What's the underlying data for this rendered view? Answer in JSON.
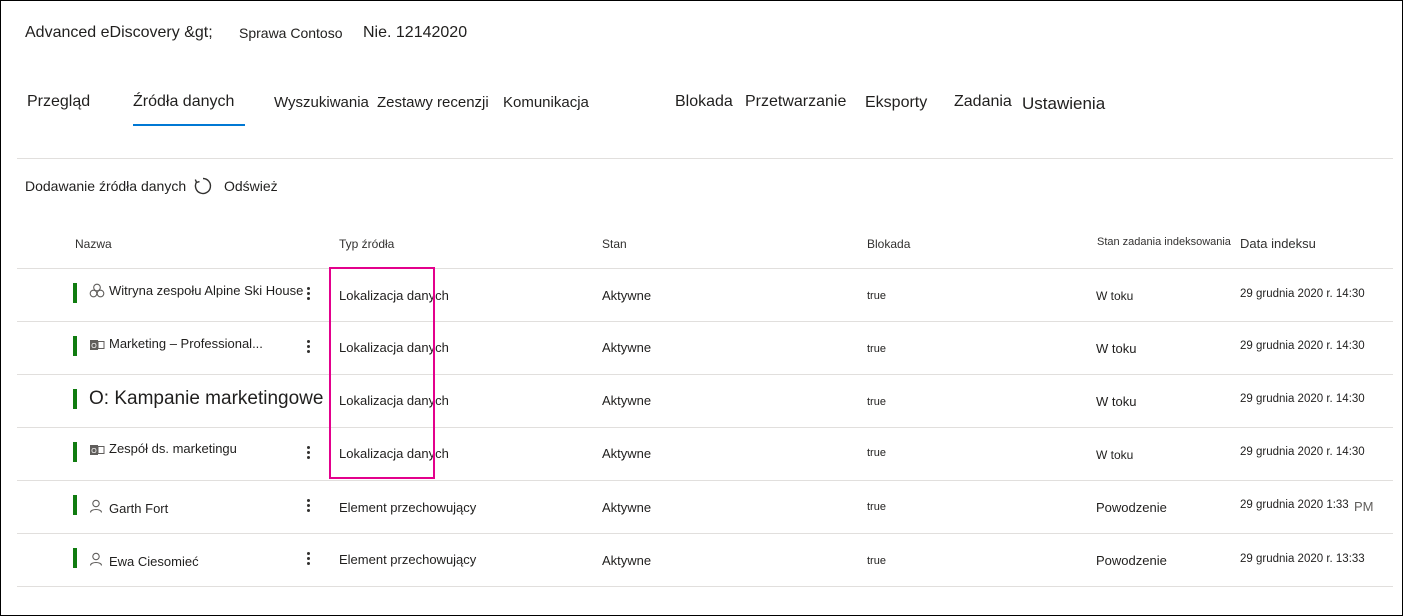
{
  "breadcrumb": {
    "root": "Advanced eDiscovery &gt;",
    "case": "Sprawa Contoso",
    "number": "Nie. 12142020"
  },
  "tabs": [
    {
      "label": "Przegląd"
    },
    {
      "label": "Źródła danych",
      "active": true
    },
    {
      "label": "Wyszukiwania"
    },
    {
      "label": "Zestawy recenzji"
    },
    {
      "label": "Komunikacja"
    },
    {
      "label": "Blokada"
    },
    {
      "label": "Przetwarzanie"
    },
    {
      "label": "Eksporty"
    },
    {
      "label": "Zadania"
    },
    {
      "label": "Ustawienia"
    }
  ],
  "commands": {
    "add_source": "Dodawanie źródła danych",
    "refresh": "Odśwież"
  },
  "table": {
    "headers": {
      "name": "Nazwa",
      "source_type": "Typ źródła",
      "status": "Stan",
      "hold": "Blokada",
      "index_status": "Stan zadania indeksowania",
      "index_date": "Data indeksu"
    },
    "rows": [
      {
        "icon": "sharepoint-site-icon",
        "name": "Witryna zespołu Alpine Ski House",
        "source_type": "Lokalizacja danych",
        "status": "Aktywne",
        "hold": "true",
        "index_status": "W toku",
        "index_date": "29 grudnia 2020 r. 14:30"
      },
      {
        "icon": "office-group-icon",
        "name": "Marketing – Professional...",
        "source_type": "Lokalizacja danych",
        "status": "Aktywne",
        "hold": "true",
        "index_status": "W toku",
        "index_date": "29 grudnia 2020 r. 14:30"
      },
      {
        "icon": "",
        "name": "O: Kampanie marketingowe",
        "source_type": "Lokalizacja danych",
        "status": "Aktywne",
        "hold": "true",
        "index_status": "W toku",
        "index_date": "29 grudnia 2020 r. 14:30"
      },
      {
        "icon": "office-group-icon",
        "name": "Zespół ds. marketingu",
        "source_type": "Lokalizacja danych",
        "status": "Aktywne",
        "hold": "true",
        "index_status": "W toku",
        "index_date": "29 grudnia 2020 r. 14:30"
      },
      {
        "icon": "person-icon",
        "name": "Garth Fort",
        "source_type": "Element przechowujący",
        "status": "Aktywne",
        "hold": "true",
        "index_status": "Powodzenie",
        "index_date": "29 grudnia 2020 1:33",
        "index_date_suffix": "PM"
      },
      {
        "icon": "person-icon",
        "name": "Ewa Ciesomieć",
        "source_type": "Element przechowujący",
        "status": "Aktywne",
        "hold": "true",
        "index_status": "Powodzenie",
        "index_date": "29 grudnia 2020 r. 13:33"
      }
    ]
  },
  "colors": {
    "active_tab_underline": "#0078d4",
    "status_bar": "#107c10",
    "highlight_box": "#e3008c"
  }
}
